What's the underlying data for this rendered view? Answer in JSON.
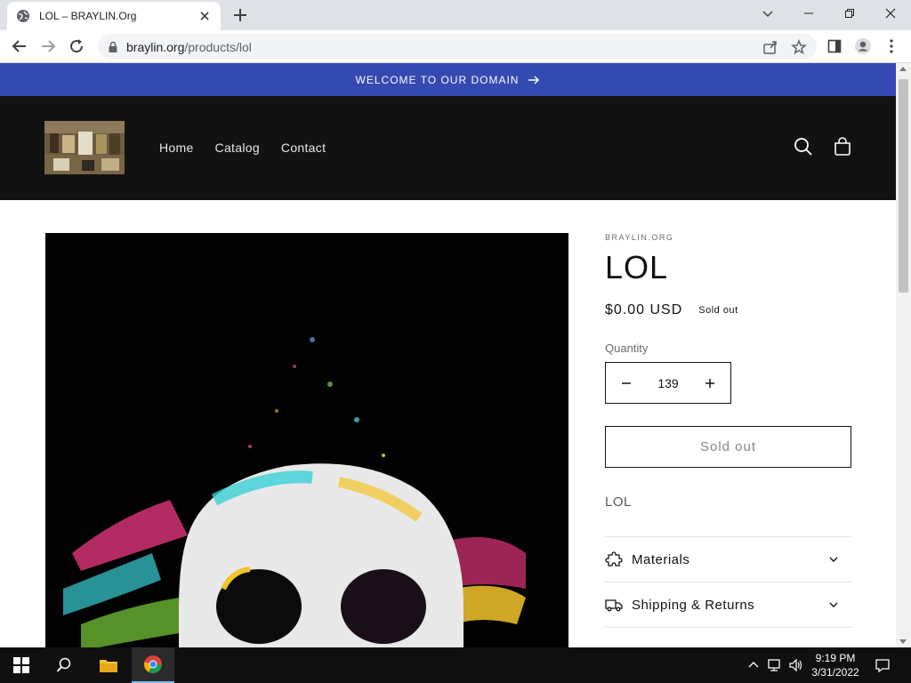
{
  "browser": {
    "tab_title": "LOL – BRAYLIN.Org",
    "url_host": "braylin.org",
    "url_path": "/products/lol"
  },
  "announcement": {
    "text": "WELCOME TO OUR DOMAIN"
  },
  "nav": {
    "items": [
      "Home",
      "Catalog",
      "Contact"
    ]
  },
  "product": {
    "vendor": "BRAYLIN.ORG",
    "title": "LOL",
    "price": "$0.00 USD",
    "badge": "Sold out",
    "quantity_label": "Quantity",
    "quantity_value": "139",
    "button_label": "Sold out",
    "description": "LOL",
    "accordion": [
      {
        "label": "Materials",
        "icon": "puzzle-icon"
      },
      {
        "label": "Shipping & Returns",
        "icon": "truck-icon"
      }
    ]
  },
  "taskbar": {
    "time": "9:19 PM",
    "date": "3/31/2022"
  },
  "colors": {
    "announcement_bg": "#3449b2",
    "header_bg": "#121212"
  }
}
